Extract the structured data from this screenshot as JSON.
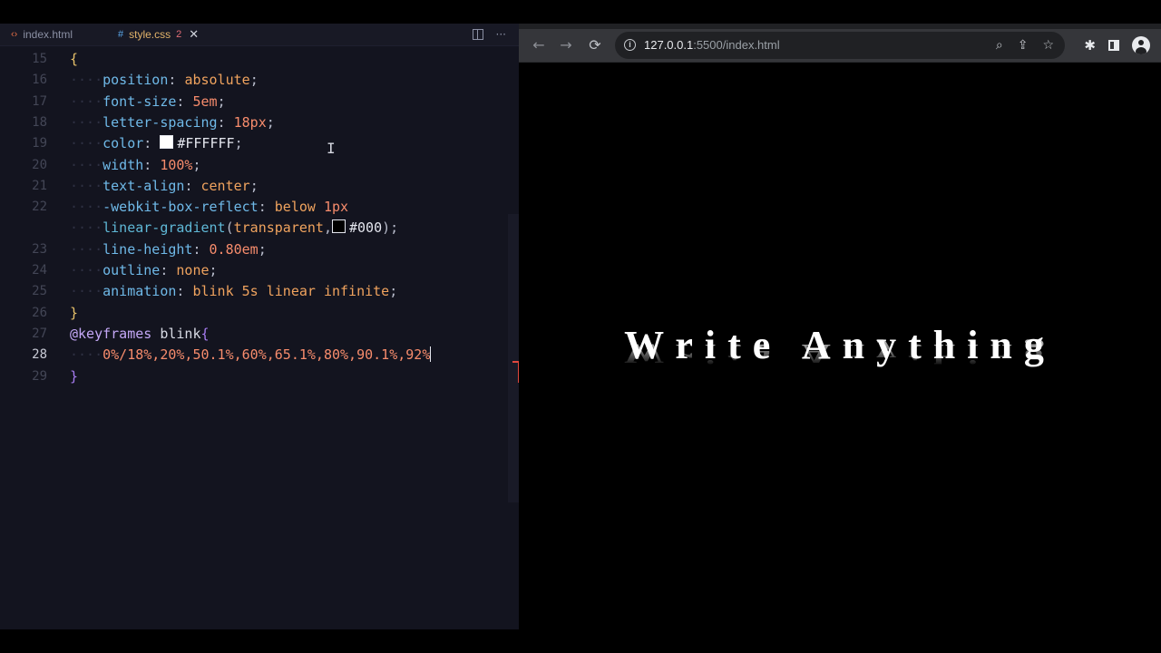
{
  "editor": {
    "tabs": [
      {
        "label": "index.html",
        "icon": "html-file-icon"
      },
      {
        "label": "style.css",
        "icon": "css-file-icon",
        "badge": "2"
      }
    ],
    "close_glyph": "✕",
    "more_glyph": "···",
    "lines": [
      {
        "n": "15",
        "segments": [
          {
            "c": "brace2",
            "t": "{"
          }
        ]
      },
      {
        "n": "16",
        "segments": [
          {
            "c": "indent",
            "t": "····"
          },
          {
            "c": "prop",
            "t": "position"
          },
          {
            "c": "punc",
            "t": ": "
          },
          {
            "c": "val",
            "t": "absolute"
          },
          {
            "c": "punc",
            "t": ";"
          }
        ]
      },
      {
        "n": "17",
        "segments": [
          {
            "c": "indent",
            "t": "····"
          },
          {
            "c": "prop",
            "t": "font-size"
          },
          {
            "c": "punc",
            "t": ": "
          },
          {
            "c": "num",
            "t": "5em"
          },
          {
            "c": "punc",
            "t": ";"
          }
        ]
      },
      {
        "n": "18",
        "segments": [
          {
            "c": "indent",
            "t": "····"
          },
          {
            "c": "prop",
            "t": "letter-spacing"
          },
          {
            "c": "punc",
            "t": ": "
          },
          {
            "c": "num",
            "t": "18px"
          },
          {
            "c": "punc",
            "t": ";"
          }
        ]
      },
      {
        "n": "19",
        "segments": [
          {
            "c": "indent",
            "t": "····"
          },
          {
            "c": "prop",
            "t": "color"
          },
          {
            "c": "punc",
            "t": ": "
          },
          {
            "c": "swatch-w",
            "t": ""
          },
          {
            "c": "white",
            "t": "#FFFFFF"
          },
          {
            "c": "punc",
            "t": ";"
          }
        ]
      },
      {
        "n": "20",
        "segments": [
          {
            "c": "indent",
            "t": "····"
          },
          {
            "c": "prop",
            "t": "width"
          },
          {
            "c": "punc",
            "t": ": "
          },
          {
            "c": "num",
            "t": "100%"
          },
          {
            "c": "punc",
            "t": ";"
          }
        ]
      },
      {
        "n": "21",
        "segments": [
          {
            "c": "indent",
            "t": "····"
          },
          {
            "c": "prop",
            "t": "text-align"
          },
          {
            "c": "punc",
            "t": ": "
          },
          {
            "c": "val",
            "t": "center"
          },
          {
            "c": "punc",
            "t": ";"
          }
        ]
      },
      {
        "n": "22",
        "segments": [
          {
            "c": "indent",
            "t": "····"
          },
          {
            "c": "prop",
            "t": "-webkit-box-reflect"
          },
          {
            "c": "punc",
            "t": ": "
          },
          {
            "c": "val",
            "t": "below "
          },
          {
            "c": "num",
            "t": "1px"
          }
        ]
      },
      {
        "n": "",
        "segments": [
          {
            "c": "indent",
            "t": "····"
          },
          {
            "c": "fn",
            "t": "linear-gradient"
          },
          {
            "c": "punc",
            "t": "("
          },
          {
            "c": "val",
            "t": "transparent"
          },
          {
            "c": "punc",
            "t": ","
          },
          {
            "c": "swatch-b",
            "t": ""
          },
          {
            "c": "white",
            "t": "#000"
          },
          {
            "c": "punc",
            "t": ");"
          }
        ]
      },
      {
        "n": "23",
        "segments": [
          {
            "c": "indent",
            "t": "····"
          },
          {
            "c": "prop",
            "t": "line-height"
          },
          {
            "c": "punc",
            "t": ": "
          },
          {
            "c": "num",
            "t": "0.80em"
          },
          {
            "c": "punc",
            "t": ";"
          }
        ]
      },
      {
        "n": "24",
        "segments": [
          {
            "c": "indent",
            "t": "····"
          },
          {
            "c": "prop",
            "t": "outline"
          },
          {
            "c": "punc",
            "t": ": "
          },
          {
            "c": "val",
            "t": "none"
          },
          {
            "c": "punc",
            "t": ";"
          }
        ]
      },
      {
        "n": "25",
        "segments": [
          {
            "c": "indent",
            "t": "····"
          },
          {
            "c": "prop",
            "t": "animation"
          },
          {
            "c": "punc",
            "t": ": "
          },
          {
            "c": "val",
            "t": "blink 5s linear infinite"
          },
          {
            "c": "punc",
            "t": ";"
          }
        ]
      },
      {
        "n": "26",
        "segments": [
          {
            "c": "brace2",
            "t": "}"
          }
        ]
      },
      {
        "n": "27",
        "segments": [
          {
            "c": "kw",
            "t": "@keyframes"
          },
          {
            "c": "sel",
            "t": " blink"
          },
          {
            "c": "brace",
            "t": "{"
          }
        ]
      },
      {
        "n": "28",
        "active": true,
        "segments": [
          {
            "c": "indent",
            "t": "····"
          },
          {
            "c": "num",
            "t": "0%/18%,20%,50.1%,60%,65.1%,80%,90.1%,92%"
          },
          {
            "c": "caret",
            "t": ""
          }
        ]
      },
      {
        "n": "29",
        "segments": [
          {
            "c": "brace",
            "t": "}"
          }
        ]
      }
    ]
  },
  "browser": {
    "url_host": "127.0.0.1",
    "url_rest": ":5500/index.html",
    "headline": "Write Anything",
    "icons": {
      "back": "←",
      "forward": "→",
      "reload": "⟳",
      "zoom": "⌕",
      "share": "⇪",
      "star": "☆",
      "extensions": "✱"
    }
  }
}
